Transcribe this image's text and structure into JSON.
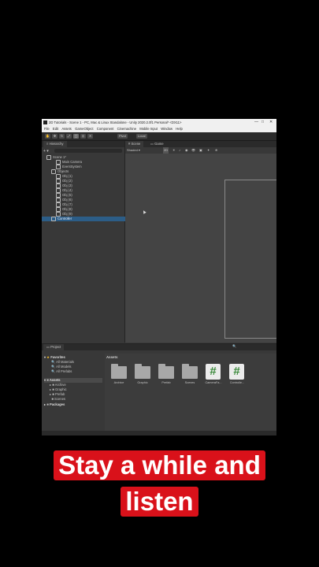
{
  "window": {
    "title": "2D Tutorials - Scene 1 - PC, Mac & Linux Standalone - Unity 2020.2.0f1 Personal* <DX11>",
    "controls": [
      "—",
      "□",
      "✕"
    ]
  },
  "menu": [
    "File",
    "Edit",
    "Assets",
    "GameObject",
    "Component",
    "Cinemachine",
    "Mobile Input",
    "Window",
    "Help"
  ],
  "toolbar": {
    "pivot_label": "Pivot",
    "local_label": "Local"
  },
  "hierarchy": {
    "tab_label": "Hierarchy",
    "rows": [
      {
        "label": "Scene 1*",
        "indent": 0,
        "selected": false
      },
      {
        "label": "Main Camera",
        "indent": 2,
        "selected": false
      },
      {
        "label": "EventSystem",
        "indent": 2,
        "selected": false
      },
      {
        "label": "Objects",
        "indent": 1,
        "selected": false
      },
      {
        "label": "Obj (1)",
        "indent": 2,
        "selected": false
      },
      {
        "label": "Obj (2)",
        "indent": 2,
        "selected": false
      },
      {
        "label": "Obj (3)",
        "indent": 2,
        "selected": false
      },
      {
        "label": "Obj (4)",
        "indent": 2,
        "selected": false
      },
      {
        "label": "Obj (5)",
        "indent": 2,
        "selected": false
      },
      {
        "label": "Obj (6)",
        "indent": 2,
        "selected": false
      },
      {
        "label": "Obj (7)",
        "indent": 2,
        "selected": false
      },
      {
        "label": "Obj (8)",
        "indent": 2,
        "selected": false
      },
      {
        "label": "Obj (9)",
        "indent": 2,
        "selected": false
      },
      {
        "label": "Controller",
        "indent": 1,
        "selected": true
      }
    ]
  },
  "scene": {
    "tab_scene": "Scene",
    "tab_game": "Game",
    "shading_mode": "Shaded",
    "mode_2d": "2D"
  },
  "project": {
    "tab_label": "Project",
    "favorites_label": "Favorites",
    "favorites": [
      "All Materials",
      "All Models",
      "All Prefabs"
    ],
    "assets_label": "Assets",
    "asset_folders": [
      "Archive",
      "Graphic",
      "Prefab",
      "Scenes"
    ],
    "packages_label": "Packages",
    "breadcrumb": "Assets",
    "items": [
      {
        "label": "Archive",
        "kind": "folder"
      },
      {
        "label": "Graphic",
        "kind": "folder"
      },
      {
        "label": "Prefab",
        "kind": "folder"
      },
      {
        "label": "Scenes",
        "kind": "folder"
      },
      {
        "label": "CameraFa...",
        "kind": "script"
      },
      {
        "label": "Controlle...",
        "kind": "script"
      }
    ]
  },
  "caption": {
    "line1": "Stay a while and",
    "line2": "listen"
  }
}
